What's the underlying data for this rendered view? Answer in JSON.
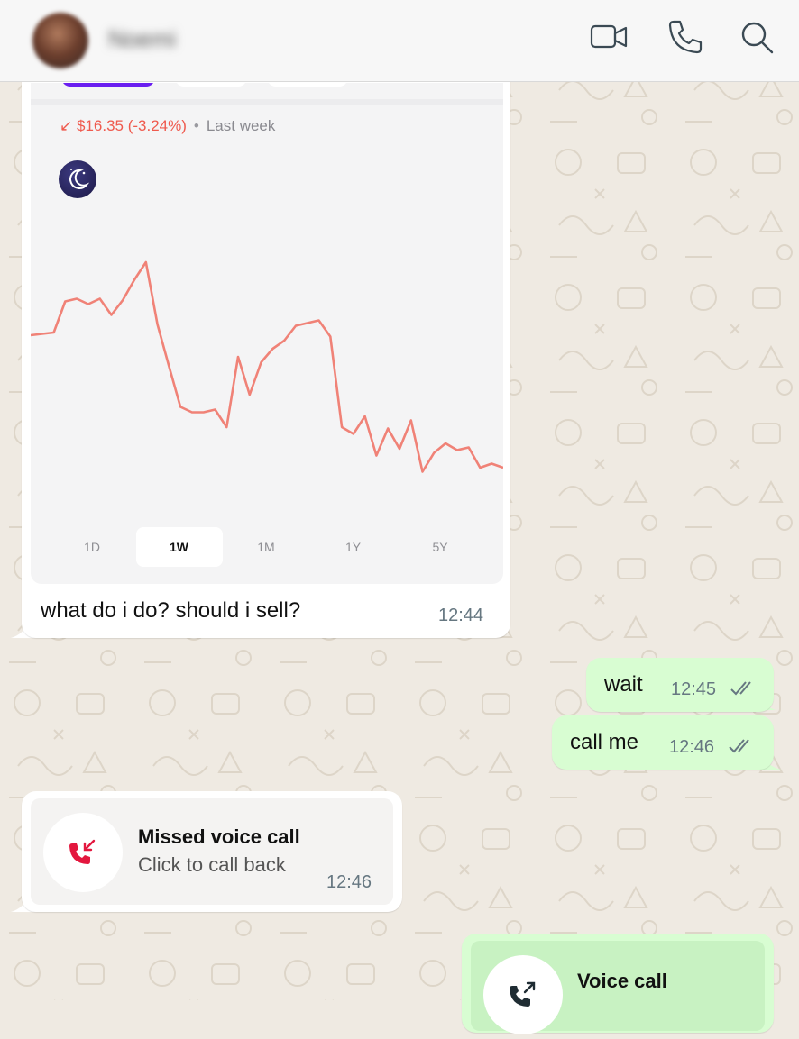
{
  "header": {
    "contact_name": "Noemi",
    "icons": [
      "video-call-icon",
      "phone-icon",
      "search-icon"
    ]
  },
  "stock_card": {
    "change_arrow": "↙",
    "change_value": "$16.35 (-3.24%)",
    "separator": "•",
    "period": "Last week",
    "logo_icon": "crescent-moon-icon",
    "line_color": "#f08277",
    "ranges": [
      "1D",
      "1W",
      "1M",
      "1Y",
      "5Y"
    ],
    "active_range": "1W"
  },
  "chart_data": {
    "type": "line",
    "title": "",
    "xlabel": "",
    "ylabel": "",
    "series": [
      {
        "values": [
          100,
          100.5,
          101,
          112.5,
          113.5,
          111.5,
          113.5,
          107.5,
          113,
          120.5,
          127,
          104,
          88.5,
          73.5,
          71.5,
          71.5,
          72.5,
          66,
          92,
          78,
          90,
          95,
          98,
          103.5,
          104.5,
          105.5,
          99.5,
          66,
          63.5,
          70,
          55.5,
          65.5,
          58,
          68.5,
          49.5,
          56.5,
          60,
          57.5,
          58.5,
          51,
          52.5,
          51
        ]
      }
    ],
    "grid": false,
    "legend": "none"
  },
  "messages": {
    "stock_caption": "what do i do? should i sell?",
    "stock_time": "12:44",
    "wait_text": "wait",
    "wait_time": "12:45",
    "call_me_text": "call me",
    "call_me_time": "12:46",
    "missed_call_title": "Missed voice call",
    "missed_call_sub": "Click to call back",
    "missed_call_time": "12:46",
    "voice_call_title": "Voice call"
  },
  "colors": {
    "outgoing_bubble": "#d8fdd2",
    "incoming_bubble": "#ffffff",
    "wallpaper": "#efeae2",
    "missed_call_red": "#e3173e",
    "read_ticks": "#667781"
  }
}
